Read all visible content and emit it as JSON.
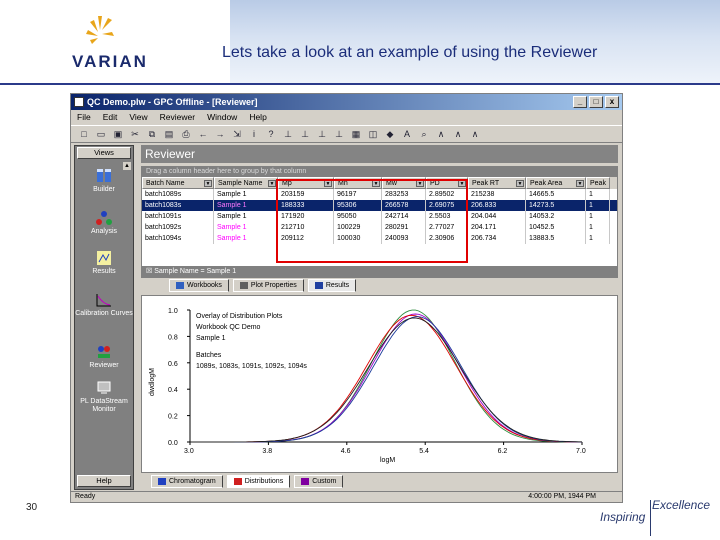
{
  "slide": {
    "title": "Lets take a look at an example of using the Reviewer",
    "logo_text": "VARIAN",
    "page_number": "30",
    "tagline_1": "Inspiring",
    "tagline_2": "Excellence",
    "brand_color": "#1a2a6c"
  },
  "window": {
    "title": "QC Demo.plw - GPC Offline - [Reviewer]",
    "buttons": [
      "_",
      "□",
      "x"
    ]
  },
  "menu": [
    "File",
    "Edit",
    "View",
    "Reviewer",
    "Window",
    "Help"
  ],
  "toolbar_icons": [
    "new-icon",
    "open-icon",
    "save-icon",
    "cut-icon",
    "copy-icon",
    "paste-icon",
    "print-icon",
    "back-icon",
    "forward-icon",
    "export-icon",
    "info-icon",
    "help-icon",
    "axis-icon",
    "axis-icon",
    "axis-icon",
    "axis-icon",
    "table-icon",
    "overlay-icon",
    "stack-icon",
    "text-icon",
    "zoom-icon",
    "peak-icon",
    "peak-icon",
    "peak-icon"
  ],
  "sidebar": {
    "views_label": "Views",
    "help_label": "Help",
    "items": [
      {
        "label": "Builder",
        "icon": "builder-icon"
      },
      {
        "label": "Analysis",
        "icon": "analysis-icon"
      },
      {
        "label": "Results",
        "icon": "results-icon"
      },
      {
        "label": "Calibration Curves",
        "icon": "calibration-icon"
      },
      {
        "label": "Reviewer",
        "icon": "reviewer-icon"
      },
      {
        "label": "PL DataStream Monitor",
        "icon": "monitor-icon"
      }
    ]
  },
  "reviewer": {
    "header": "Reviewer",
    "group_hint": "Drag a column header here to group by that column",
    "columns": [
      "Batch Name",
      "Sample Name",
      "Mp",
      "Mn",
      "Mw",
      "PD",
      "Peak RT",
      "Peak Area",
      "Peak"
    ],
    "rows": [
      {
        "cells": [
          "batch1089s",
          "Sample 1",
          "203159",
          "96197",
          "283253",
          "2.89502",
          "215238",
          "14665.5",
          "1"
        ],
        "selected": false,
        "pink": false
      },
      {
        "cells": [
          "batch1083s",
          "Sample 1",
          "188333",
          "95306",
          "266578",
          "2.69075",
          "206.833",
          "14273.5",
          "1"
        ],
        "selected": true,
        "pink": true
      },
      {
        "cells": [
          "batch1091s",
          "Sample 1",
          "171920",
          "95050",
          "242714",
          "2.5503",
          "204.044",
          "14053.2",
          "1"
        ],
        "selected": false,
        "pink": false
      },
      {
        "cells": [
          "batch1092s",
          "Sample 1",
          "212710",
          "100229",
          "280291",
          "2.77027",
          "204.171",
          "10452.5",
          "1"
        ],
        "selected": false,
        "pink": true
      },
      {
        "cells": [
          "batch1094s",
          "Sample 1",
          "209112",
          "100030",
          "240093",
          "2.30906",
          "206.734",
          "13883.5",
          "1"
        ],
        "selected": false,
        "pink": true
      }
    ],
    "filter_text": "Sample Name = Sample 1"
  },
  "subtabs": [
    {
      "label": "Workbooks",
      "active": false
    },
    {
      "label": "Plot Properties",
      "active": false
    },
    {
      "label": "Results",
      "active": true
    }
  ],
  "bottom_tabs": [
    {
      "label": "Chromatogram",
      "active": false
    },
    {
      "label": "Distributions",
      "active": true
    },
    {
      "label": "Custom",
      "active": false
    }
  ],
  "status": {
    "left": "Ready",
    "right": "4:00:00 PM, 1944 PM"
  },
  "chart_data": {
    "type": "line",
    "annotation_lines": [
      "Overlay of Distribution Plots",
      "Workbook QC Demo",
      "Sample 1",
      "Batches",
      "1089s, 1083s, 1091s, 1092s, 1094s"
    ],
    "xlabel": "logM",
    "ylabel": "dwdlogM",
    "x_ticks": [
      "3.0",
      "3.8",
      "4.6",
      "5.4",
      "6.2",
      "7.0"
    ],
    "y_ticks": [
      "1.0",
      "0.8",
      "0.6",
      "0.4",
      "0.2",
      "0.0"
    ],
    "xlim": [
      3.0,
      7.0
    ],
    "ylim": [
      0.0,
      1.0
    ],
    "series": [
      {
        "color": "#2e8b3e",
        "center": 5.28,
        "height": 1.0,
        "width": 0.6
      },
      {
        "color": "#9a00cc",
        "center": 5.3,
        "height": 0.97,
        "width": 0.62
      },
      {
        "color": "#e00000",
        "center": 5.26,
        "height": 0.96,
        "width": 0.64
      },
      {
        "color": "#1a3a9a",
        "center": 5.32,
        "height": 0.95,
        "width": 0.63
      },
      {
        "color": "#202020",
        "center": 5.29,
        "height": 0.94,
        "width": 0.66
      }
    ]
  }
}
